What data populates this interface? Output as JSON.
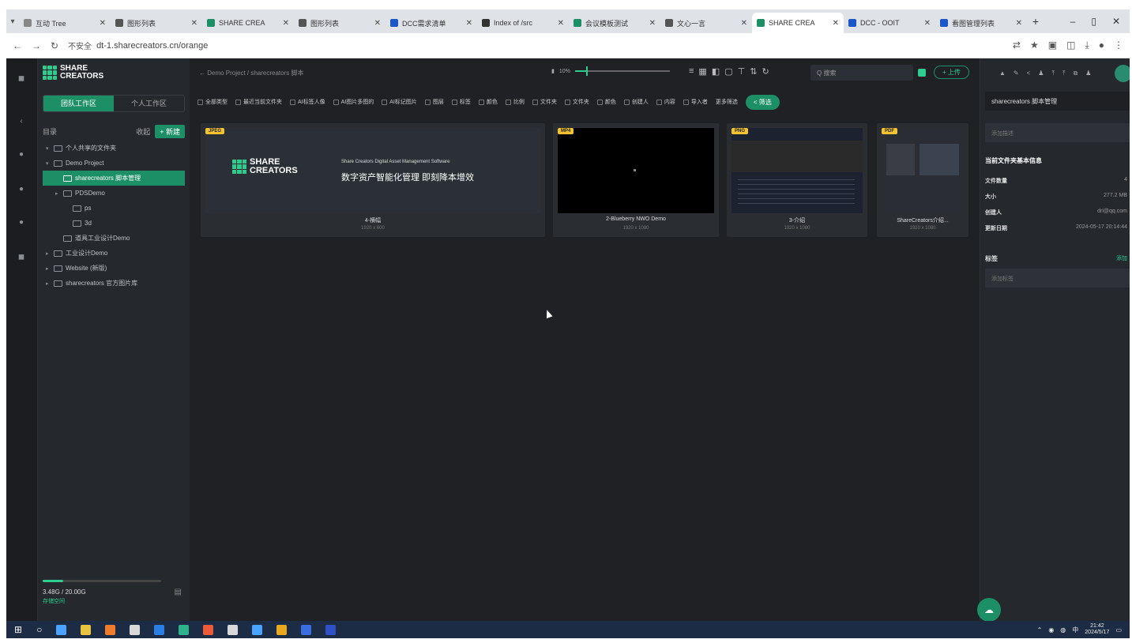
{
  "browser": {
    "tabs": [
      {
        "title": "互动 Tree",
        "color": "#888"
      },
      {
        "title": "图形列表",
        "color": "#555"
      },
      {
        "title": "SHARE CREA",
        "color": "#1d8f67"
      },
      {
        "title": "图形列表",
        "color": "#555"
      },
      {
        "title": "DCC需求清单",
        "color": "#1a56c8"
      },
      {
        "title": "Index of /src",
        "color": "#333"
      },
      {
        "title": "会议模板测试",
        "color": "#1d8f67"
      },
      {
        "title": "文心一言",
        "color": "#555"
      },
      {
        "title": "SHARE CREA",
        "color": "#1d8f67",
        "active": true
      },
      {
        "title": "DCC - OOIT",
        "color": "#1a56c8"
      },
      {
        "title": "看图管理列表",
        "color": "#1a56c8"
      }
    ],
    "url": "dt-1.sharecreators.cn/orange",
    "security_label": "不安全"
  },
  "sidebar": {
    "logo_line1": "SHARE",
    "logo_line2": "CREATORS",
    "tab_team": "团队工作区",
    "tab_personal": "个人工作区",
    "tree_label": "目录",
    "collapse_label": "收起",
    "new_button": "+ 新建",
    "tree": [
      {
        "label": "个人共享的文件夹",
        "depth": 0,
        "arrow": "▾"
      },
      {
        "label": "Demo Project",
        "depth": 0,
        "arrow": "▾"
      },
      {
        "label": "sharecreators 脚本管理",
        "depth": 1,
        "arrow": "",
        "selected": true
      },
      {
        "label": "PDSDemo",
        "depth": 1,
        "arrow": "▸"
      },
      {
        "label": "ps",
        "depth": 2,
        "arrow": ""
      },
      {
        "label": "3d",
        "depth": 2,
        "arrow": ""
      },
      {
        "label": "道具工业设计Demo",
        "depth": 1,
        "arrow": ""
      },
      {
        "label": "工业设计Demo",
        "depth": 0,
        "arrow": "▸"
      },
      {
        "label": "Website (新版)",
        "depth": 0,
        "arrow": "▸"
      },
      {
        "label": "sharecreators 官方图片库",
        "depth": 0,
        "arrow": "▸"
      }
    ],
    "storage_text": "3.48G / 20.00G",
    "storage_label": "存储空间",
    "storage_fraction": 0.17
  },
  "main": {
    "breadcrumb": "← Demo Project / sharecreators 脚本",
    "zoom_label": "10%",
    "zoom_fraction": 0.12,
    "search_placeholder": "Q 搜索",
    "upload_label": "+ 上传",
    "filters": [
      "全部类型",
      "最近当前文件夹",
      "AI标签人像",
      "AI图片多图的",
      "AI标记图片"
    ],
    "filter_checks": [
      "图层",
      "标签",
      "颜色",
      "比例",
      "文件夹",
      "文件夹",
      "颜色",
      "创建人",
      "内容",
      "导入者"
    ],
    "more_filter": "更多筛选",
    "filter_button": "< 筛选",
    "cards": [
      {
        "badge": "JPEG",
        "name": "4-横幅",
        "meta": "1920 x 600"
      },
      {
        "badge": "MP4",
        "name": "2-Blueberry NWO Demo",
        "meta": "1920 x 1080"
      },
      {
        "badge": "PNG",
        "name": "3-介绍",
        "meta": "1920 x 1080"
      },
      {
        "badge": "PDF",
        "name": "ShareCreators介绍...",
        "meta": "1920 x 1080"
      }
    ],
    "banner_brand_line1": "SHARE",
    "banner_brand_line2": "CREATORS",
    "banner_en": "Share Creators Digital Asset Management Software",
    "banner_cn": "数字资产智能化管理 即刻降本增效"
  },
  "rpanel": {
    "title": "sharecreators 脚本管理",
    "desc_placeholder": "添加描述",
    "section_info": "当前文件夹基本信息",
    "rows": [
      {
        "k": "文件数量",
        "v": "4"
      },
      {
        "k": "大小",
        "v": "277.2 MB"
      },
      {
        "k": "创建人",
        "v": "dri@qq.com"
      },
      {
        "k": "更新日期",
        "v": "2024-05-17 20:14:44"
      }
    ],
    "tags_label": "标签",
    "tags_action": "添加",
    "tags_placeholder": "添加标签"
  },
  "taskbar": {
    "icons": [
      "#4aa3ff",
      "#e8c340",
      "#f07b2a",
      "#d8d8d8",
      "#2a7ee6",
      "#2fb38b",
      "#ec5a3a",
      "#d8d8d8",
      "#4aa3ff",
      "#e8a81f",
      "#3a6de0",
      "#3050c8"
    ],
    "time": "21:42",
    "date": "2024/5/17",
    "ime": "中"
  }
}
